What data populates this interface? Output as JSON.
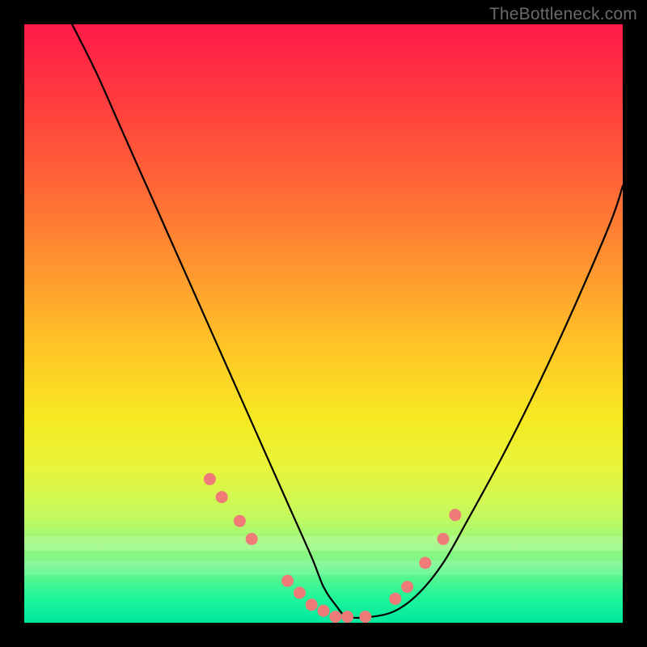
{
  "watermark": "TheBottleneck.com",
  "chart_data": {
    "type": "line",
    "title": "",
    "xlabel": "",
    "ylabel": "",
    "xlim": [
      0,
      100
    ],
    "ylim": [
      0,
      100
    ],
    "grid": false,
    "legend": false,
    "annotations": [],
    "series": [
      {
        "name": "curve",
        "style": "solid-black",
        "x": [
          8,
          12,
          16,
          20,
          24,
          28,
          32,
          36,
          40,
          44,
          48,
          50,
          52,
          54,
          58,
          62,
          66,
          70,
          74,
          80,
          86,
          92,
          98,
          100
        ],
        "y": [
          100,
          92,
          83,
          74,
          65,
          56,
          47,
          38,
          29,
          20,
          11,
          6,
          3,
          1,
          1,
          2,
          5,
          10,
          17,
          28,
          40,
          53,
          67,
          73
        ]
      },
      {
        "name": "highlight-dots",
        "style": "salmon-dots",
        "x": [
          31,
          33,
          36,
          38,
          44,
          46,
          48,
          50,
          52,
          54,
          57,
          62,
          64,
          67,
          70,
          72
        ],
        "y": [
          24,
          21,
          17,
          14,
          7,
          5,
          3,
          2,
          1,
          1,
          1,
          4,
          6,
          10,
          14,
          18
        ]
      }
    ]
  }
}
